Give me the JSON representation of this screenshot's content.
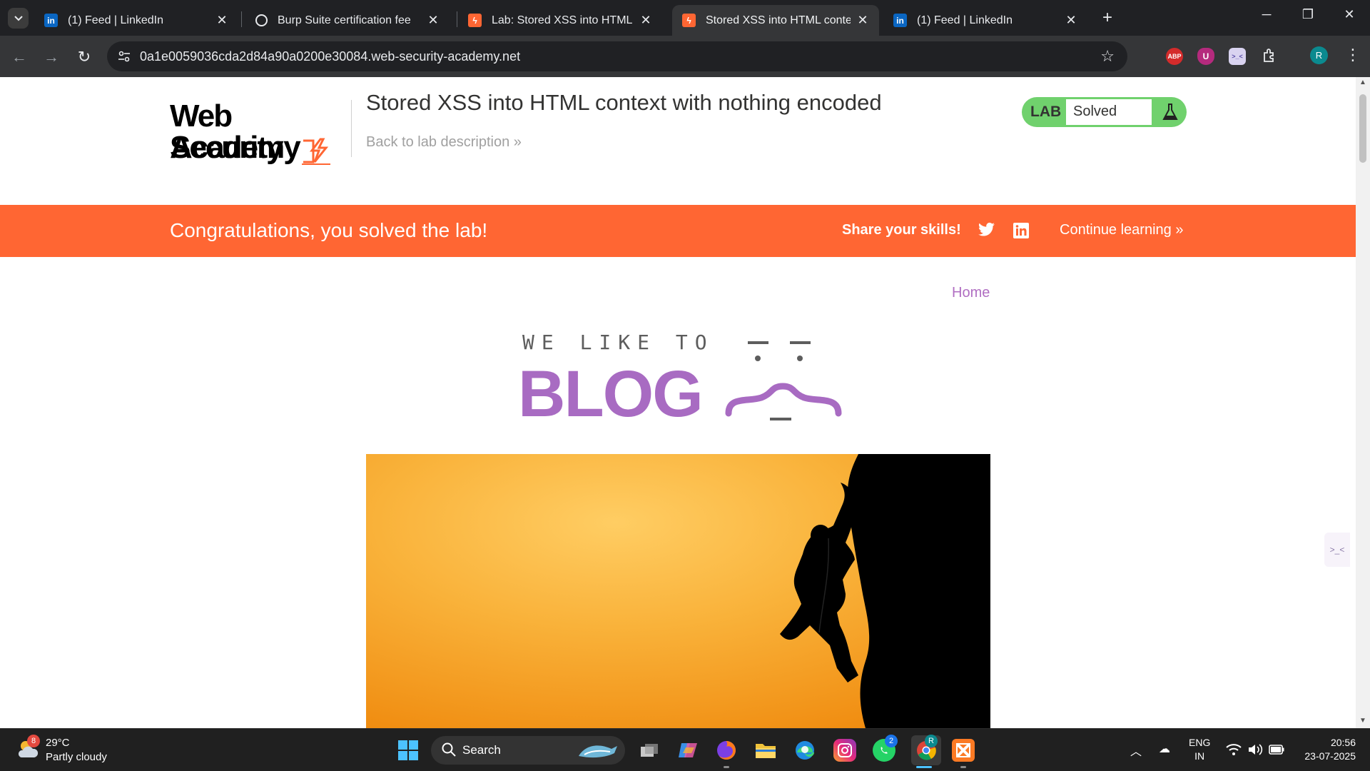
{
  "browser": {
    "tabs": [
      {
        "title": "(1) Feed | LinkedIn",
        "favicon": "linkedin-icon",
        "active": false
      },
      {
        "title": "Burp Suite certification fee",
        "favicon": "chatgpt-icon",
        "active": false
      },
      {
        "title": "Lab: Stored XSS into HTML cont",
        "favicon": "portswigger-icon",
        "active": false
      },
      {
        "title": "Stored XSS into HTML context w",
        "favicon": "portswigger-icon",
        "active": true
      },
      {
        "title": "(1) Feed | LinkedIn",
        "favicon": "linkedin-icon",
        "active": false
      }
    ],
    "url": "0a1e0059036cda2d84a90a0200e30084.web-security-academy.net",
    "extensions": [
      {
        "name": "adblock-plus-icon",
        "label": "ABP",
        "color": "#d42b2b"
      },
      {
        "name": "ublock-icon",
        "label": "U",
        "color": "#b52a7d"
      },
      {
        "name": "extension-badge-icon",
        "label": ">_<",
        "color": "#7b6fd6"
      }
    ],
    "profile_initial": "R"
  },
  "header": {
    "logo_line1": "Web Security",
    "logo_line2": "Academy",
    "lab_title": "Stored XSS into HTML context with nothing encoded",
    "back_link": "Back to lab description »",
    "lab_label": "LAB",
    "lab_status": "Solved",
    "status_color": "#70d16d"
  },
  "banner": {
    "message": "Congratulations, you solved the lab!",
    "share": "Share your skills!",
    "continue": "Continue learning »",
    "color": "#ff6633"
  },
  "blog": {
    "home_link": "Home",
    "tagline": "WE LIKE TO",
    "logo_word": "BLOG",
    "accent": "#a86bc2"
  },
  "taskbar": {
    "weather_temp": "29°C",
    "weather_desc": "Partly cloudy",
    "weather_badge": "8",
    "search_label": "Search",
    "whatsapp_badge": "2",
    "lang_top": "ENG",
    "lang_bottom": "IN",
    "time": "20:56",
    "date": "23-07-2025"
  }
}
